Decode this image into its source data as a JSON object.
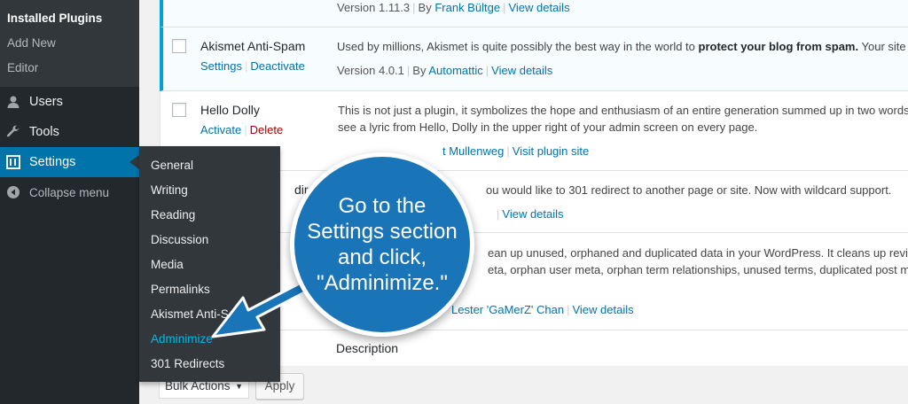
{
  "sidebar": {
    "submenu": [
      {
        "label": "Installed Plugins",
        "current": true
      },
      {
        "label": "Add New",
        "current": false
      },
      {
        "label": "Editor",
        "current": false
      }
    ],
    "menu": [
      {
        "label": "Users",
        "icon": "users-icon"
      },
      {
        "label": "Tools",
        "icon": "wrench-icon"
      },
      {
        "label": "Settings",
        "icon": "settings-icon",
        "active": true
      },
      {
        "label": "Collapse menu",
        "icon": "collapse-icon"
      }
    ]
  },
  "flyout": {
    "items": [
      "General",
      "Writing",
      "Reading",
      "Discussion",
      "Media",
      "Permalinks",
      "Akismet Anti-S",
      "Adminimize",
      "301 Redirects"
    ],
    "current": "Adminimize"
  },
  "plugins": {
    "row0": {
      "meta_version": "Version 1.11.3",
      "meta_by": "By",
      "meta_author": "Frank Bültge",
      "meta_details": "View details"
    },
    "row1": {
      "name": "Akismet Anti-Spam",
      "action1": "Settings",
      "action2": "Deactivate",
      "desc_start": "Used by millions, Akismet is quite possibly the best way in the world to",
      "desc_bold": "protect your blog from spam.",
      "desc_end": "Your site is",
      "meta_version": "Version 4.0.1",
      "meta_by": "By",
      "meta_author": "Automattic",
      "meta_details": "View details"
    },
    "row2": {
      "name": "Hello Dolly",
      "action1": "Activate",
      "action2": "Delete",
      "desc_line1": "This is not just a plugin, it symbolizes the hope and enthusiasm of an entire generation summed up in two words",
      "desc_line2": "see a lyric from Hello, Dolly in the upper right of your admin screen on every page.",
      "meta_author": "t Mullenweg",
      "meta_site": "Visit plugin site"
    },
    "row3": {
      "name_frag": "dir",
      "desc": "ou would like to 301 redirect to another page or site. Now with wildcard support.",
      "meta_details": "View details"
    },
    "row4": {
      "desc_line1": "ean up unused, orphaned and duplicated data in your WordPress. It cleans up revision",
      "desc_line2": "eta, orphan user meta, orphan term relationships, unused terms, duplicated post meta,",
      "meta_author": "Lester 'GaMerZ' Chan",
      "meta_details": "View details"
    },
    "footer_description": "Description"
  },
  "bulk": {
    "select_label": "Bulk Actions",
    "apply_label": "Apply"
  },
  "callout": {
    "lines": [
      "Go to the",
      "Settings section",
      "and click,",
      "\"Adminimize.\""
    ],
    "color": "#1a75b8"
  }
}
